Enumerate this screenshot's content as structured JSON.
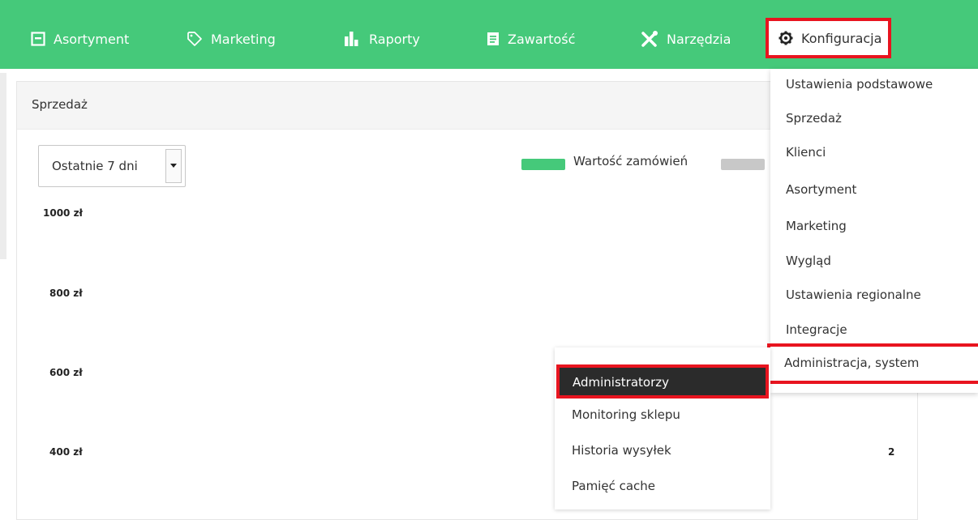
{
  "nav": {
    "items": [
      {
        "label": "Asortyment",
        "icon": "box-icon"
      },
      {
        "label": "Marketing",
        "icon": "tag-icon"
      },
      {
        "label": "Raporty",
        "icon": "bar-chart-icon"
      },
      {
        "label": "Zawartość",
        "icon": "document-icon"
      },
      {
        "label": "Narzędzia",
        "icon": "tools-icon"
      },
      {
        "label": "Konfiguracja",
        "icon": "gear-icon",
        "active": true
      }
    ],
    "color": "#45c97a"
  },
  "panel": {
    "title": "Sprzedaż",
    "period": "Ostatnie 7 dni"
  },
  "legend": {
    "items": [
      {
        "label": "Wartość zamówień",
        "color": "#45c97a"
      },
      {
        "label": "",
        "color": "#c8c8c8"
      }
    ]
  },
  "chart_data": {
    "type": "bar",
    "title": "",
    "ytick_labels": [
      "1000 zł",
      "800 zł",
      "600 zł",
      "400 zł"
    ],
    "visible_data_labels": [
      "2"
    ]
  },
  "config_menu": {
    "items": [
      "Ustawienia podstawowe",
      "Sprzedaż",
      "Klienci",
      "Asortyment",
      "Marketing",
      "Wygląd",
      "Ustawienia regionalne",
      "Integracje",
      "Administracja, system"
    ],
    "highlighted": "Administracja, system"
  },
  "submenu": {
    "items": [
      "Administratorzy",
      "Monitoring sklepu",
      "Historia wysyłek",
      "Pamięć cache"
    ],
    "selected": "Administratorzy"
  },
  "highlight_color": "#e8141f"
}
